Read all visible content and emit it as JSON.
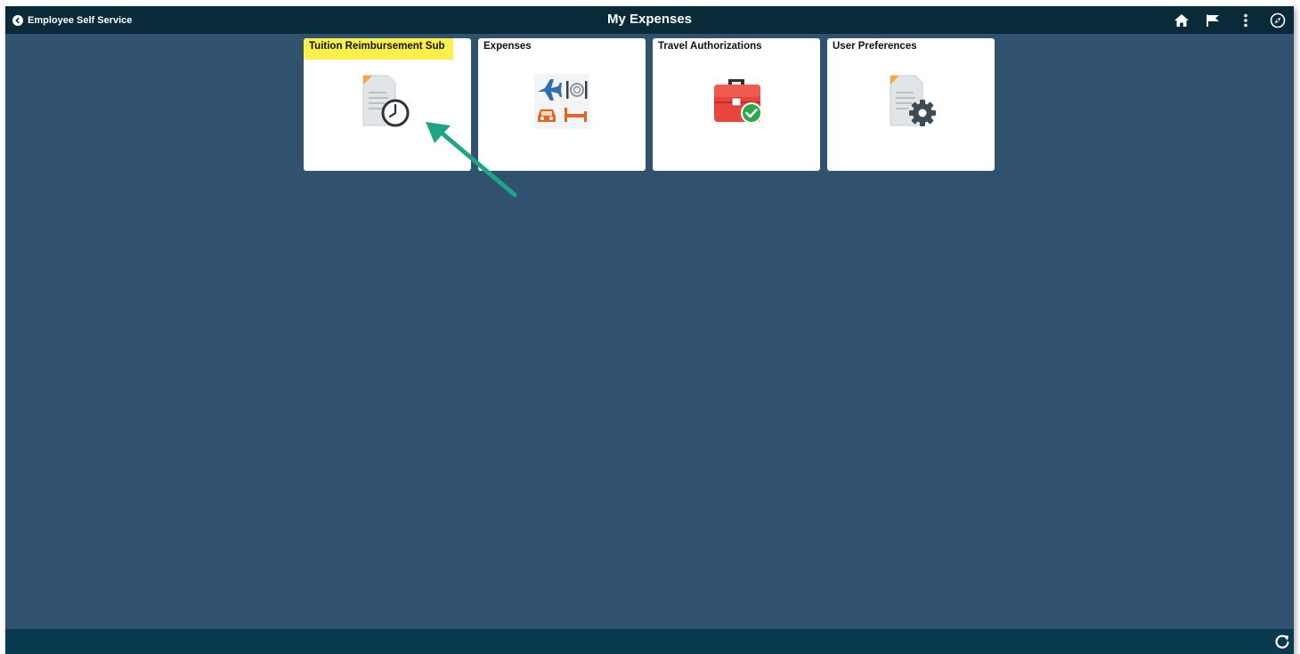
{
  "header": {
    "back_label": "Employee Self Service",
    "title": "My Expenses",
    "icons": [
      "home-icon",
      "flag-icon",
      "more-vertical-icon",
      "navbar-compass-icon"
    ]
  },
  "tiles": [
    {
      "title": "Tuition Reimbursement Sub",
      "icon": "document-clock-icon",
      "highlighted": true
    },
    {
      "title": "Expenses",
      "icon": "expenses-travel-icon"
    },
    {
      "title": "Travel Authorizations",
      "icon": "briefcase-check-icon"
    },
    {
      "title": "User Preferences",
      "icon": "document-gear-icon"
    }
  ],
  "footer": {
    "icons": [
      "refresh-icon"
    ]
  },
  "colors": {
    "page_background": "#30526e",
    "header_background": "#0a2a3a",
    "footer_background": "#0a3a50",
    "highlight": "#fbf04a",
    "annotation_arrow": "#1fa586"
  }
}
